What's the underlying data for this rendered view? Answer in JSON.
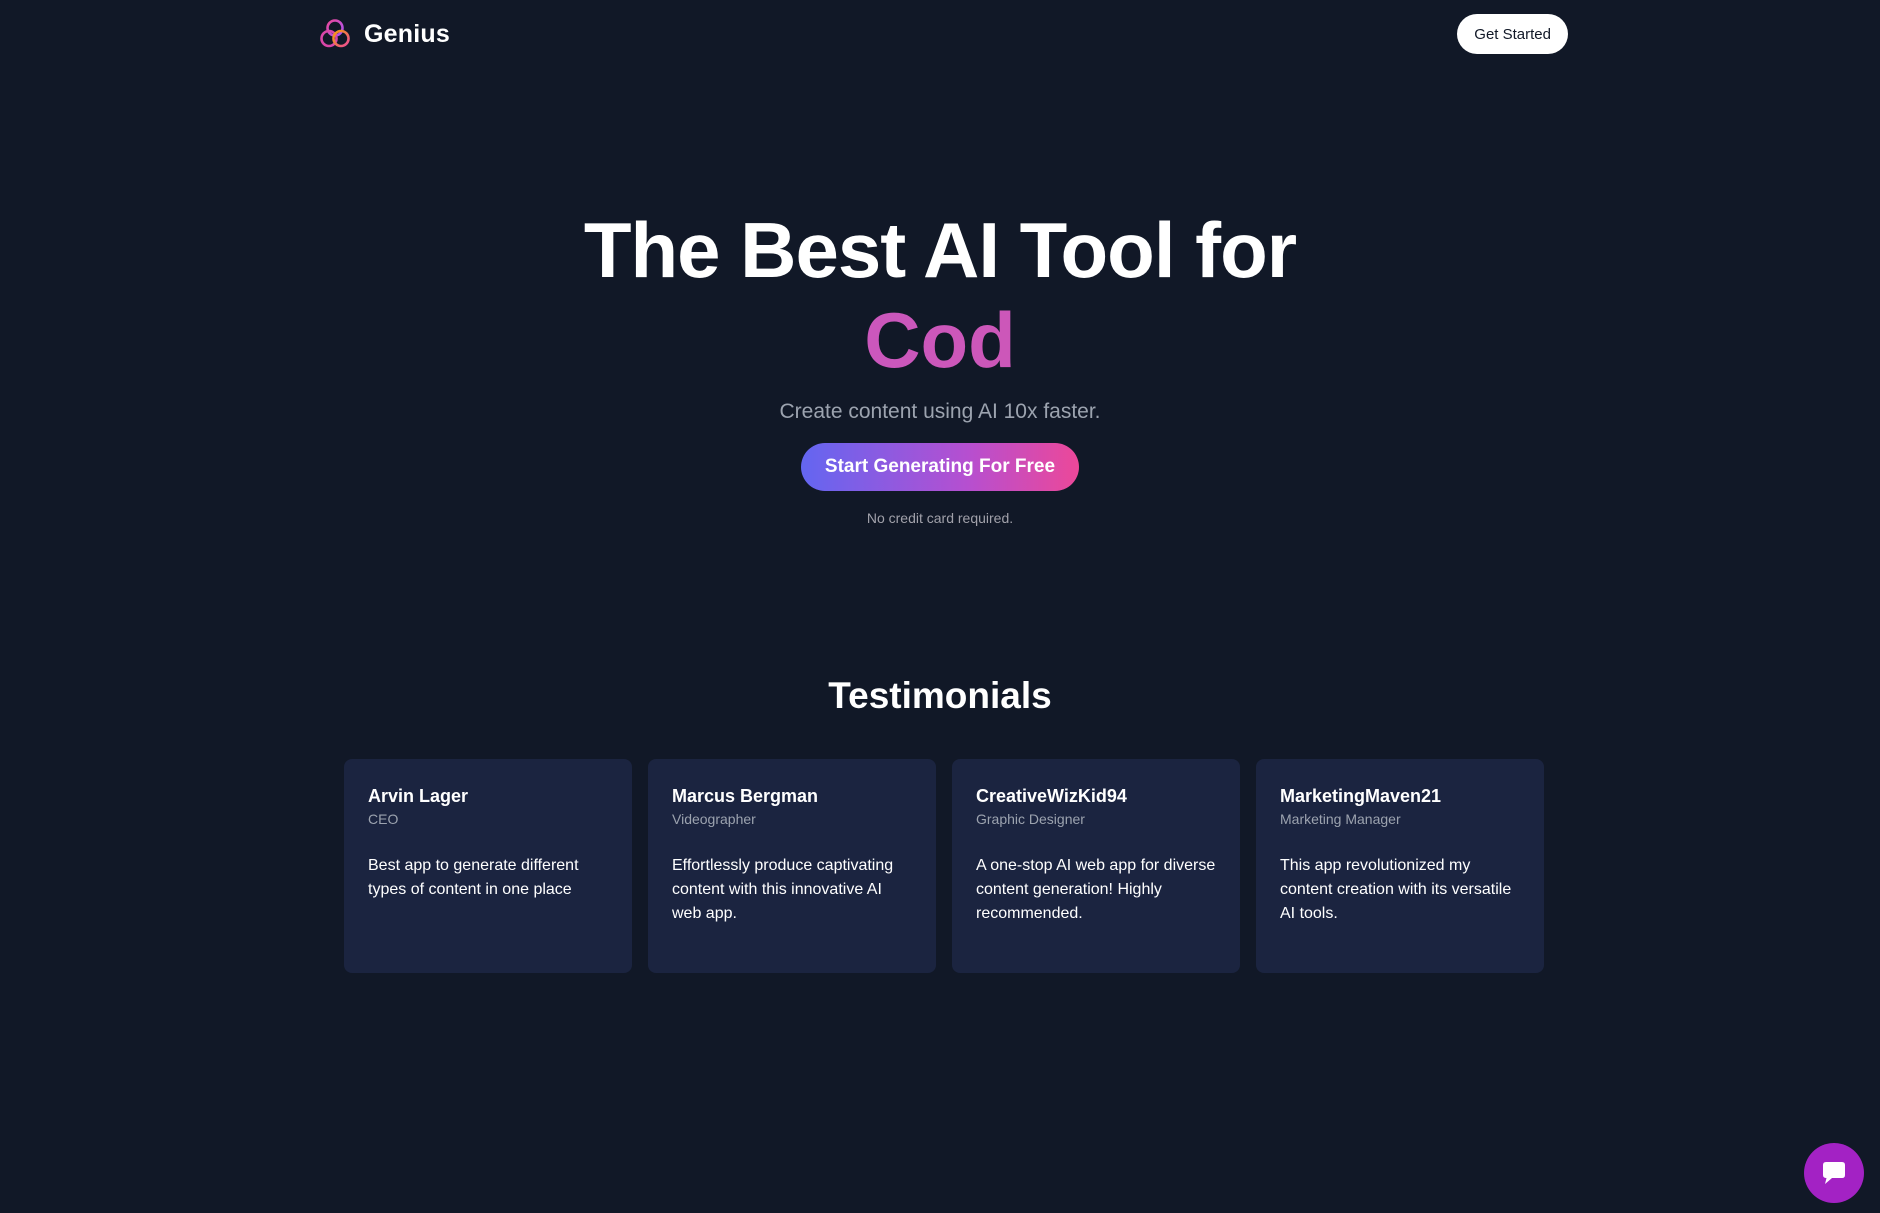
{
  "navbar": {
    "brand_name": "Genius",
    "logo_icon": "three-rings-logo-icon",
    "cta_label": "Get Started"
  },
  "hero": {
    "title": "The Best AI Tool for",
    "typed_text": "Cod",
    "subtitle": "Create content using AI 10x faster.",
    "cta_label": "Start Generating For Free",
    "note": "No credit card required."
  },
  "testimonials": {
    "heading": "Testimonials",
    "items": [
      {
        "name": "Arvin Lager",
        "role": "CEO",
        "quote": "Best app to generate different types of content in one place"
      },
      {
        "name": "Marcus Bergman",
        "role": "Videographer",
        "quote": "Effortlessly produce captivating content with this innovative AI web app."
      },
      {
        "name": "CreativeWizKid94",
        "role": "Graphic Designer",
        "quote": "A one-stop AI web app for diverse content generation! Highly recommended."
      },
      {
        "name": "MarketingMaven21",
        "role": "Marketing Manager",
        "quote": "This app revolutionized my content creation with its versatile AI tools."
      }
    ]
  },
  "chat_widget": {
    "icon": "chat-icon"
  },
  "colors": {
    "background": "#111827",
    "card_background": "#1b2440",
    "typed_text_gradient_start": "#c454cf",
    "typed_text_gradient_end": "#d35aa6",
    "cta_gradient_start": "#6366f1",
    "cta_gradient_end": "#ec4899",
    "chat_bubble": "#a322c4"
  }
}
